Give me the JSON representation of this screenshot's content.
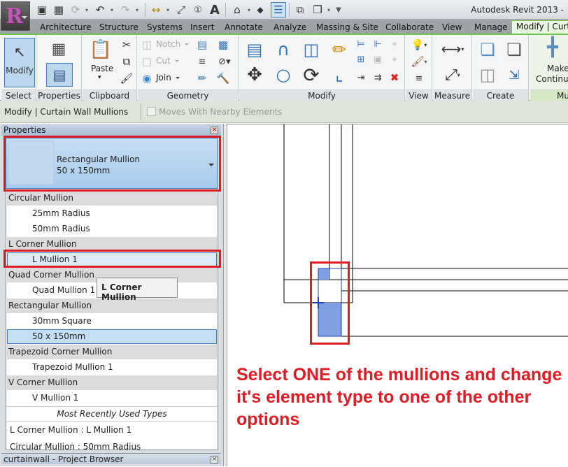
{
  "app": {
    "title": "Autodesk Revit 2013 -",
    "app_button_letter": "R"
  },
  "quick_access": [
    {
      "icon": "open-icon",
      "glyph": "📂"
    },
    {
      "icon": "save-icon",
      "glyph": "💾"
    },
    {
      "icon": "sync-icon",
      "glyph": "⟳"
    },
    {
      "icon": "undo-icon",
      "glyph": "↶"
    },
    {
      "icon": "redo-icon",
      "glyph": "↷"
    },
    {
      "icon": "measure-icon",
      "glyph": "↔"
    },
    {
      "icon": "aligned-dimension-icon",
      "glyph": "⤢"
    },
    {
      "icon": "tag-icon",
      "glyph": "ⓘ"
    },
    {
      "icon": "text-icon",
      "glyph": "A"
    },
    {
      "icon": "3d-view-icon",
      "glyph": "⌂"
    },
    {
      "icon": "section-icon",
      "glyph": "◆"
    },
    {
      "icon": "thin-lines-icon",
      "glyph": "☰"
    },
    {
      "icon": "close-hidden-windows-icon",
      "glyph": "⧉"
    },
    {
      "icon": "switch-windows-icon",
      "glyph": "❐"
    },
    {
      "icon": "customize-toolbar-icon",
      "glyph": "▾"
    }
  ],
  "tabs": [
    {
      "label": "Architecture"
    },
    {
      "label": "Structure"
    },
    {
      "label": "Systems"
    },
    {
      "label": "Insert"
    },
    {
      "label": "Annotate"
    },
    {
      "label": "Analyze"
    },
    {
      "label": "Massing & Site"
    },
    {
      "label": "Collaborate"
    },
    {
      "label": "View"
    },
    {
      "label": "Manage"
    },
    {
      "label": "Modify | Curta",
      "active": true
    }
  ],
  "ribbon": {
    "select": {
      "label": "Select",
      "modify": "Modify"
    },
    "properties": {
      "label": "Properties"
    },
    "clipboard": {
      "label": "Clipboard",
      "paste": "Paste"
    },
    "geometry": {
      "label": "Geometry",
      "notch": "Notch",
      "cut": "Cut",
      "join": "Join"
    },
    "modify": {
      "label": "Modify"
    },
    "view": {
      "label": "View"
    },
    "measure": {
      "label": "Measure"
    },
    "create": {
      "label": "Create"
    },
    "mullion": {
      "label": "Mu",
      "make_continuous_1": "Make",
      "make_continuous_2": "Continuo"
    }
  },
  "options_bar": {
    "context": "Modify | Curtain Wall Mullions",
    "moves_with_nearby": "Moves With Nearby Elements",
    "moves_with_nearby_checked": false
  },
  "properties": {
    "title": "Properties",
    "type_selector": {
      "family": "Rectangular Mullion",
      "type": "50 x 150mm"
    },
    "type_list": [
      {
        "kind": "group",
        "label": "Circular Mullion"
      },
      {
        "kind": "item",
        "label": "25mm Radius"
      },
      {
        "kind": "item",
        "label": "50mm Radius"
      },
      {
        "kind": "group",
        "label": "L Corner Mullion"
      },
      {
        "kind": "item",
        "label": "L Mullion 1",
        "state": "hover"
      },
      {
        "kind": "group",
        "label": "Quad Corner Mullion"
      },
      {
        "kind": "item",
        "label": "Quad Mullion 1"
      },
      {
        "kind": "group",
        "label": "Rectangular Mullion"
      },
      {
        "kind": "item",
        "label": "30mm Square"
      },
      {
        "kind": "item",
        "label": "50 x 150mm",
        "state": "selected"
      },
      {
        "kind": "group",
        "label": "Trapezoid Corner Mullion"
      },
      {
        "kind": "item",
        "label": "Trapezoid Mullion 1"
      },
      {
        "kind": "group",
        "label": "V Corner Mullion"
      },
      {
        "kind": "item",
        "label": "V Mullion 1"
      },
      {
        "kind": "mru-header",
        "label": "Most Recently Used Types"
      },
      {
        "kind": "mru",
        "label": "L Corner Mullion : L Mullion 1"
      },
      {
        "kind": "mru",
        "label": "Circular Mullion : 50mm Radius"
      }
    ],
    "tooltip": "L Corner Mullion"
  },
  "project_browser": {
    "title": "curtainwall - Project Browser"
  },
  "annotation": {
    "instruction": "Select ONE of the mullions and change it's element type to one of the other options",
    "color": "#e01b24"
  }
}
